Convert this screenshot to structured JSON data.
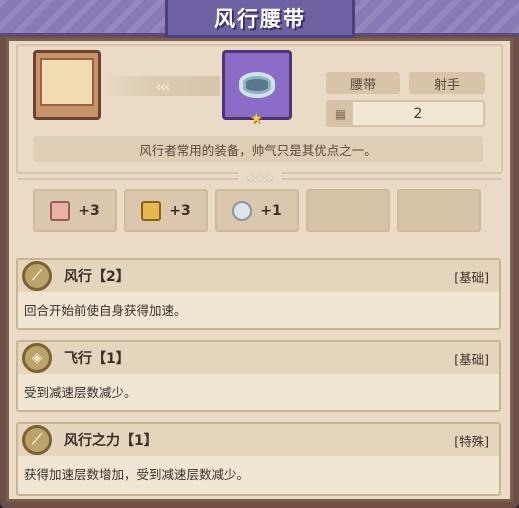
{
  "title": "风行腰带",
  "item": {
    "arrows": "‹‹‹",
    "type": "腰带",
    "class": "射手",
    "level": "2",
    "description": "风行者常用的装备，帅气只是其优点之一。"
  },
  "stats": [
    {
      "icon": "fist-icon",
      "value": "+3",
      "color": "#e7b2a8"
    },
    {
      "icon": "gold-boot-icon",
      "value": "+3",
      "color": "#e9b84c"
    },
    {
      "icon": "feather-icon",
      "value": "+1",
      "color": "#dfe4ea"
    }
  ],
  "skills": [
    {
      "name": "风行【2】",
      "category": "[基础]",
      "description": "回合开始前使自身获得加速。"
    },
    {
      "name": "飞行【1】",
      "category": "[基础]",
      "description": "受到减速层数减少。"
    },
    {
      "name": "风行之力【1】",
      "category": "[特殊]",
      "description": "获得加速层数增加，受到减速层数减少。"
    }
  ],
  "colors": {
    "header": "#8a79b4",
    "title_tab": "#6f5fa3",
    "panel": "#eadac6",
    "item_frame": "#8b6cc7"
  }
}
